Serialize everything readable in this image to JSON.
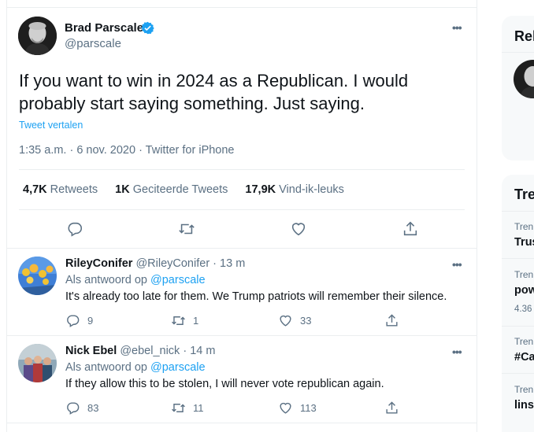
{
  "tweet": {
    "author_name": "Brad Parscale",
    "handle": "@parscale",
    "text": "If you want to win in 2024 as a Republican. I would probably start saying something. Just saying.",
    "translate_label": "Tweet vertalen",
    "meta": "1:35 a.m. · 6 nov. 2020 · Twitter for iPhone",
    "stats": {
      "retweets_count": "4,7K",
      "retweets_label": "Retweets",
      "quotes_count": "1K",
      "quotes_label": "Geciteerde Tweets",
      "likes_count": "17,9K",
      "likes_label": "Vind-ik-leuks"
    }
  },
  "replies": [
    {
      "name": "RileyConifer",
      "handle": "@RileyConifer",
      "time": "13 m",
      "reply_prefix": "Als antwoord op",
      "reply_mention": "@parscale",
      "text": "It's already too late for them. We Trump patriots will remember their silence.",
      "reply_count": "9",
      "retweet_count": "1",
      "like_count": "33"
    },
    {
      "name": "Nick Ebel",
      "handle": "@ebel_nick",
      "time": "14 m",
      "reply_prefix": "Als antwoord op",
      "reply_mention": "@parscale",
      "text": "If they allow this to be stolen, I will never vote republican again.",
      "reply_count": "83",
      "retweet_count": "11",
      "like_count": "113"
    }
  ],
  "sidebar": {
    "relevant_title": "Rel",
    "trends_title": "Tre",
    "trends": [
      {
        "label": "Tren",
        "topic": "Trus",
        "count": ""
      },
      {
        "label": "Tren",
        "topic": "pow",
        "count": "4.36"
      },
      {
        "label": "Tren",
        "topic": "#Ca",
        "count": ""
      },
      {
        "label": "Tren",
        "topic": "lins",
        "count": ""
      }
    ]
  },
  "colors": {
    "accent": "#1da1f2",
    "secondary_text": "#5b7083",
    "border": "#ebeef0"
  },
  "icons": {
    "reply": "reply-icon",
    "retweet": "retweet-icon",
    "like": "heart-icon",
    "share": "share-icon",
    "more": "more-icon",
    "verified": "verified-badge-icon"
  }
}
